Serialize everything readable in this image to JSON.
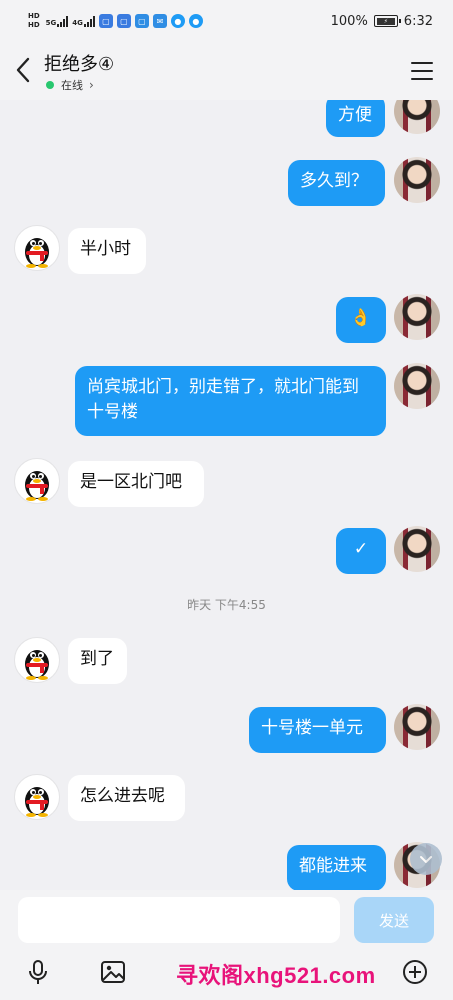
{
  "status_bar": {
    "net_top": "HD",
    "net_bottom": "HD",
    "sig1": "5G",
    "sig2": "4G",
    "battery_percent": "100%",
    "time": "6:32",
    "app_icons": [
      {
        "name": "app-icon-1",
        "color": "#3a7be0",
        "glyph": "▢"
      },
      {
        "name": "app-icon-2",
        "color": "#3a7be0",
        "glyph": "▢"
      },
      {
        "name": "app-icon-3",
        "color": "#2f8de4",
        "glyph": "▢"
      },
      {
        "name": "app-icon-4",
        "color": "#2f8de4",
        "glyph": "✉"
      },
      {
        "name": "app-icon-5",
        "color": "#1e9bf5",
        "glyph": "●"
      },
      {
        "name": "app-icon-6",
        "color": "#1e9bf5",
        "glyph": "●"
      }
    ]
  },
  "header": {
    "title": "拒绝多④",
    "status": "在线",
    "status_chevron": "›"
  },
  "messages": [
    {
      "side": "mine",
      "text": "方便"
    },
    {
      "side": "mine",
      "text": "多久到？"
    },
    {
      "side": "theirs",
      "text": "半小时"
    },
    {
      "side": "mine",
      "text": "👌"
    },
    {
      "side": "mine",
      "text": "尚宾城北门，别走错了，就北门能到十号楼"
    },
    {
      "side": "theirs",
      "text": "是一区北门吧"
    },
    {
      "side": "mine",
      "text": "✓"
    },
    {
      "side": "theirs",
      "text": "到了"
    },
    {
      "side": "mine",
      "text": "十号楼一单元"
    },
    {
      "side": "theirs",
      "text": "怎么进去呢"
    },
    {
      "side": "mine",
      "text": "都能进来"
    }
  ],
  "timestamp": "昨天 下午4:55",
  "input": {
    "placeholder": "",
    "send_label": "发送"
  },
  "colors": {
    "my_bubble": "#1e9bf5",
    "their_bubble": "#ffffff",
    "background": "#f0f0f3",
    "send_button": "#a9d6f8",
    "online": "#28c76f"
  },
  "watermark": "寻欢阁xhg521.com"
}
